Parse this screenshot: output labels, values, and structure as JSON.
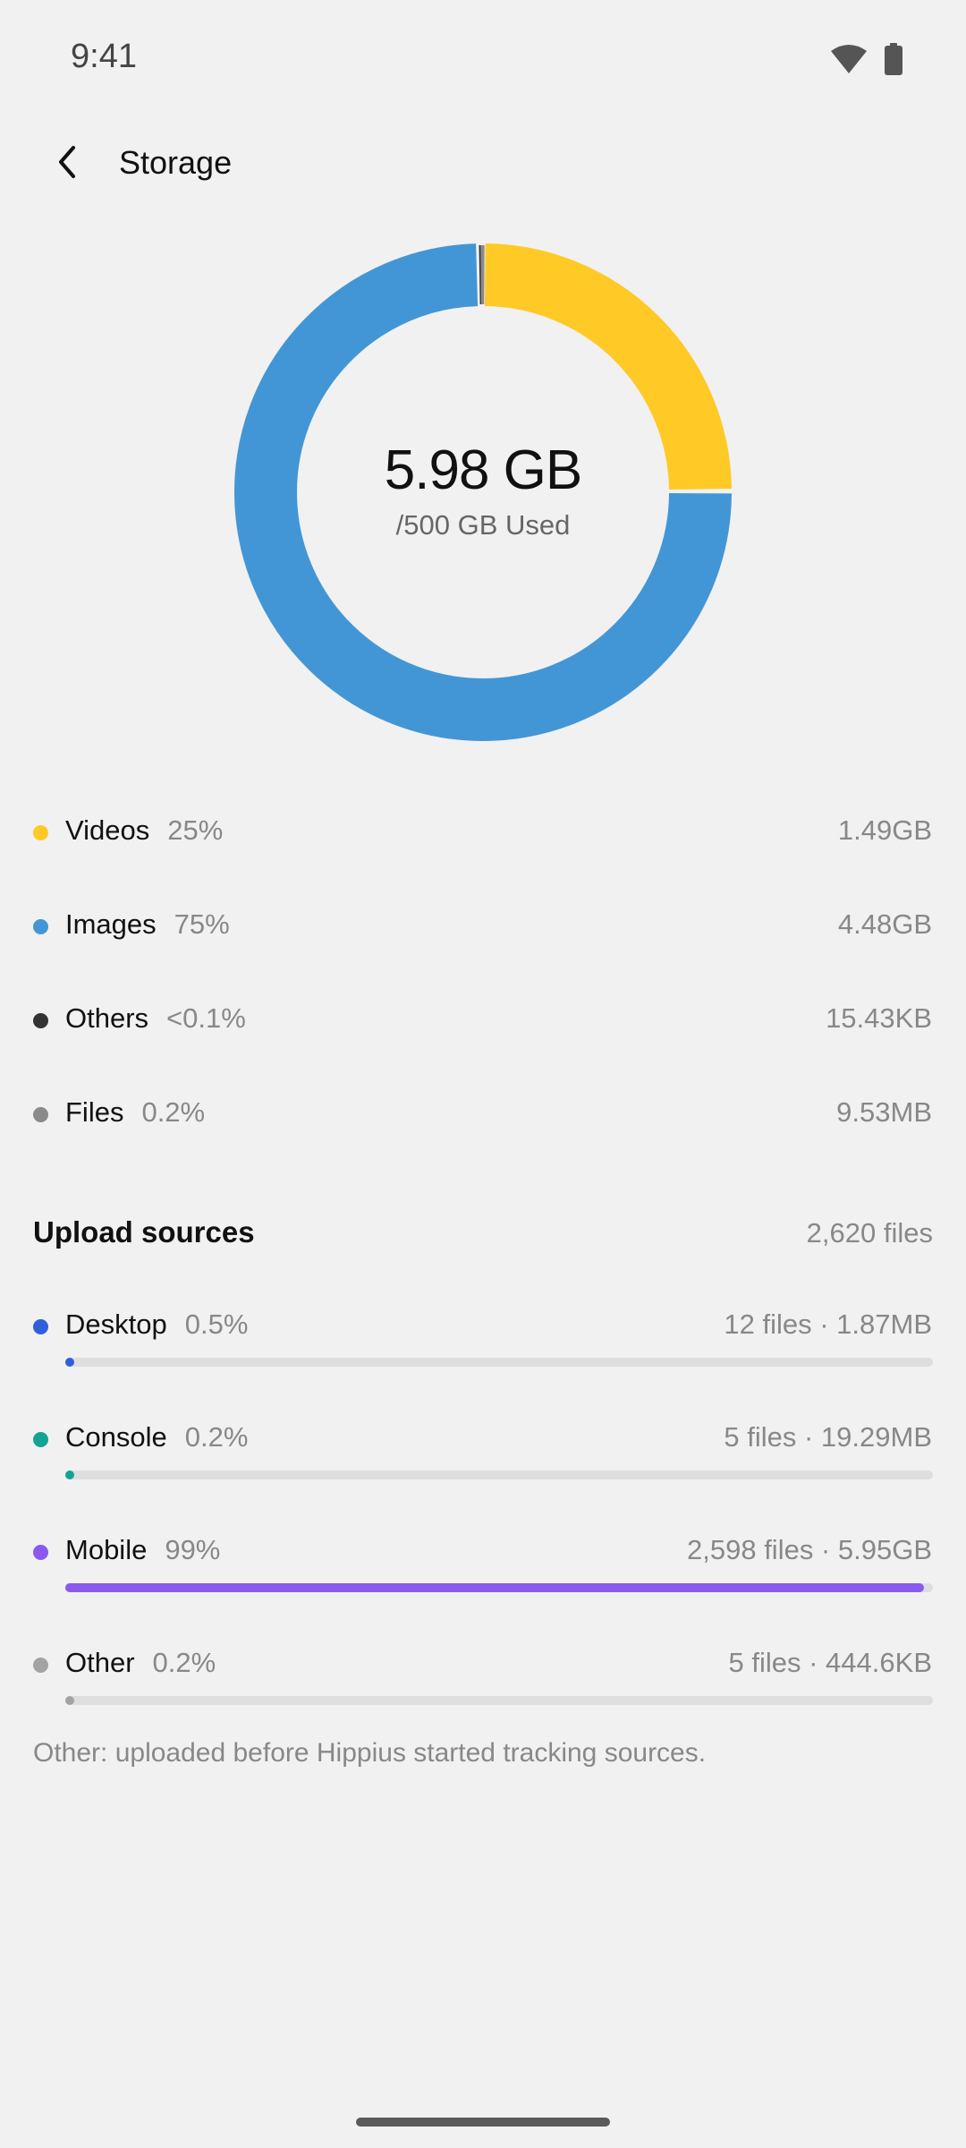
{
  "status_bar": {
    "time": "9:41"
  },
  "header": {
    "title": "Storage"
  },
  "summary": {
    "used": "5.98 GB",
    "total_label": "/500 GB Used"
  },
  "chart_data": {
    "type": "pie",
    "categories": [
      "Videos",
      "Images",
      "Others",
      "Files"
    ],
    "values": [
      25,
      75,
      0.1,
      0.2
    ],
    "colors": [
      "#ffc926",
      "#4396d6",
      "#333333",
      "#8a8a8a"
    ]
  },
  "categories": [
    {
      "name": "Videos",
      "percent": "25%",
      "size": "1.49GB",
      "color": "#ffc926"
    },
    {
      "name": "Images",
      "percent": "75%",
      "size": "4.48GB",
      "color": "#4396d6"
    },
    {
      "name": "Others",
      "percent": "<0.1%",
      "size": "15.43KB",
      "color": "#333333"
    },
    {
      "name": "Files",
      "percent": "0.2%",
      "size": "9.53MB",
      "color": "#8a8a8a"
    }
  ],
  "upload_sources": {
    "title": "Upload sources",
    "total": "2,620 files",
    "items": [
      {
        "name": "Desktop",
        "percent": "0.5%",
        "info": "12 files · 1.87MB",
        "color": "#2f5fdc",
        "fill": 0.005
      },
      {
        "name": "Console",
        "percent": "0.2%",
        "info": "5 files · 19.29MB",
        "color": "#13a394",
        "fill": 0.002
      },
      {
        "name": "Mobile",
        "percent": "99%",
        "info": "2,598 files · 5.95GB",
        "color": "#8a59ee",
        "fill": 0.99
      },
      {
        "name": "Other",
        "percent": "0.2%",
        "info": "5 files · 444.6KB",
        "color": "#a3a3a3",
        "fill": 0.002
      }
    ],
    "footnote": "Other: uploaded before Hippius started tracking sources."
  },
  "icons": {
    "back": "back-arrow-icon",
    "wifi": "wifi-icon",
    "battery": "battery-icon"
  }
}
